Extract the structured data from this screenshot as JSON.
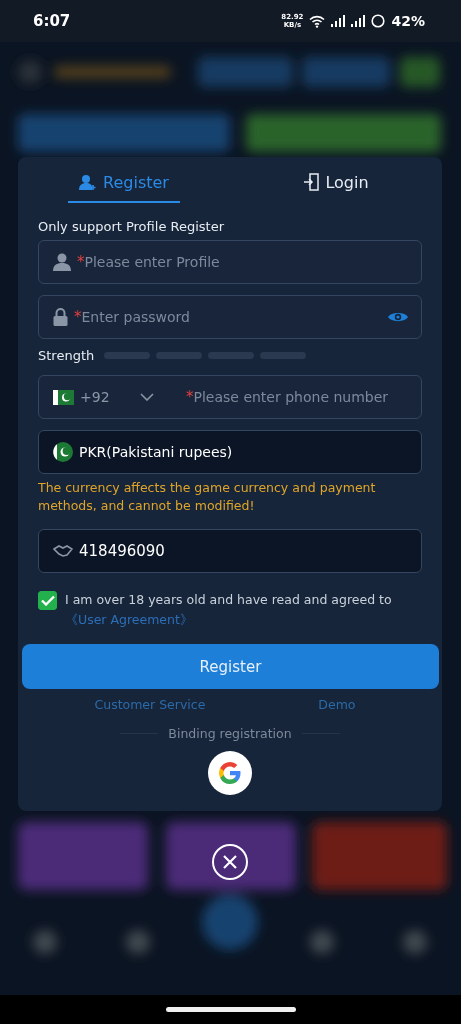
{
  "status_bar": {
    "time": "6:07",
    "speed_value": "82.92",
    "speed_unit": "KB/s",
    "battery": "42%"
  },
  "tabs": [
    {
      "label": "Register",
      "selected": true
    },
    {
      "label": "Login",
      "selected": false
    }
  ],
  "note": "Only support Profile Register",
  "profile_field": {
    "required_mark": "*",
    "placeholder": "Please enter Profile"
  },
  "password_field": {
    "required_mark": "*",
    "placeholder": "Enter password"
  },
  "strength": {
    "label": "Strength"
  },
  "phone_field": {
    "country_code": "+92",
    "required_mark": "*",
    "placeholder": "Please enter phone number"
  },
  "currency_field": {
    "value": "PKR(Pakistani rupees)"
  },
  "currency_warning": "The currency affects the game currency and payment methods, and cannot be modified!",
  "invite_field": {
    "value": "418496090"
  },
  "agreement": {
    "checked": true,
    "text": "I am over 18 years old and have read and agreed to",
    "link": "《User Agreement》"
  },
  "register_button": "Register",
  "links": [
    "Customer Service",
    "Demo"
  ],
  "binding_label": "Binding registration"
}
